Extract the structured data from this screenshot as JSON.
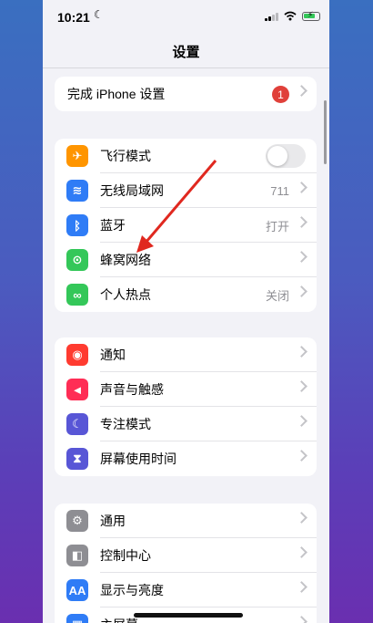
{
  "status_bar": {
    "time": "10:21"
  },
  "nav": {
    "title": "设置"
  },
  "setup_group": {
    "label": "完成 iPhone 设置",
    "badge": "1"
  },
  "network_group": [
    {
      "name": "飞行模式",
      "icon": "airplane-icon",
      "color": "#ff9500",
      "glyph": "✈",
      "toggle": false
    },
    {
      "name": "无线局域网",
      "icon": "wifi-icon",
      "color": "#2f7cf6",
      "glyph": "≋",
      "value": "711"
    },
    {
      "name": "蓝牙",
      "icon": "bluetooth-icon",
      "color": "#2f7cf6",
      "glyph": "ᛒ",
      "value": "打开"
    },
    {
      "name": "蜂窝网络",
      "icon": "cellular-antenna-icon",
      "color": "#34c759",
      "glyph": "⊙"
    },
    {
      "name": "个人热点",
      "icon": "hotspot-link-icon",
      "color": "#34c759",
      "glyph": "∞",
      "value": "关闭"
    }
  ],
  "notify_group": [
    {
      "name": "通知",
      "icon": "bell-icon",
      "color": "#ff3b30",
      "glyph": "◉"
    },
    {
      "name": "声音与触感",
      "icon": "speaker-icon",
      "color": "#ff2d55",
      "glyph": "◄"
    },
    {
      "name": "专注模式",
      "icon": "moon-icon",
      "color": "#5856d6",
      "glyph": "☾"
    },
    {
      "name": "屏幕使用时间",
      "icon": "hourglass-icon",
      "color": "#5856d6",
      "glyph": "⧗"
    }
  ],
  "general_group": [
    {
      "name": "通用",
      "icon": "gear-icon",
      "color": "#8e8e93",
      "glyph": "⚙"
    },
    {
      "name": "控制中心",
      "icon": "switches-icon",
      "color": "#8e8e93",
      "glyph": "◧"
    },
    {
      "name": "显示与亮度",
      "icon": "text-size-icon",
      "color": "#2f7cf6",
      "glyph": "AA"
    },
    {
      "name": "主屏幕",
      "icon": "home-screen-icon",
      "color": "#2f7cf6",
      "glyph": "▦"
    }
  ],
  "annotation": {
    "arrow_color": "#e0281f"
  }
}
